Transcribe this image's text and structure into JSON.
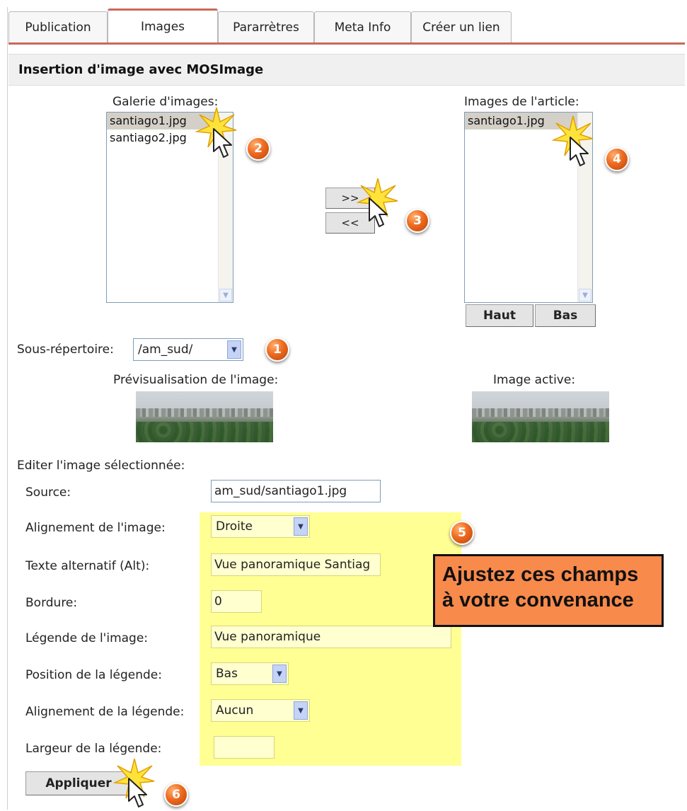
{
  "tabs": [
    {
      "label": "Publication",
      "active": false
    },
    {
      "label": "Images",
      "active": true
    },
    {
      "label": "Pararrètres",
      "active": false
    },
    {
      "label": "Meta Info",
      "active": false
    },
    {
      "label": "Créer un lien",
      "active": false
    }
  ],
  "section_title": "Insertion d'image avec MOSImage",
  "gallery": {
    "label": "Galerie d'images:",
    "items": [
      "santiago1.jpg",
      "santiago2.jpg"
    ],
    "selected": "santiago1.jpg"
  },
  "article_images": {
    "label": "Images de l'article:",
    "items": [
      "santiago1.jpg"
    ],
    "selected": "santiago1.jpg"
  },
  "transfer": {
    "add_label": ">>",
    "remove_label": "<<"
  },
  "order_buttons": {
    "up_label": "Haut",
    "down_label": "Bas"
  },
  "subdirectory": {
    "label": "Sous-répertoire:",
    "value": "/am_sud/"
  },
  "preview": {
    "label": "Prévisualisation de l'image:",
    "active_label": "Image active:"
  },
  "edit": {
    "title": "Editer l'image sélectionnée:",
    "source": {
      "label": "Source:",
      "value": "am_sud/santiago1.jpg"
    },
    "alignment": {
      "label": "Alignement de l'image:",
      "value": "Droite"
    },
    "alt_text": {
      "label": "Texte alternatif (Alt):",
      "value": "Vue panoramique Santiag"
    },
    "border": {
      "label": "Bordure:",
      "value": "0"
    },
    "caption": {
      "label": "Légende de l'image:",
      "value": "Vue panoramique"
    },
    "caption_position": {
      "label": "Position de la légende:",
      "value": "Bas"
    },
    "caption_alignment": {
      "label": "Alignement de la légende:",
      "value": "Aucun"
    },
    "caption_width": {
      "label": "Largeur de la légende:",
      "value": ""
    },
    "apply_label": "Appliquer"
  },
  "annotations": {
    "step_numbers": [
      "1",
      "2",
      "3",
      "4",
      "5",
      "6"
    ],
    "callout_text": "Ajustez ces champs à votre convenance",
    "highlight_color": "#ffff8a",
    "badge_color": "#ee6a1f",
    "callout_color": "#f88a4b"
  },
  "colors": {
    "tab_accent": "#c9695a",
    "selection": "#d4d0c8",
    "field_border": "#7f9db9"
  }
}
